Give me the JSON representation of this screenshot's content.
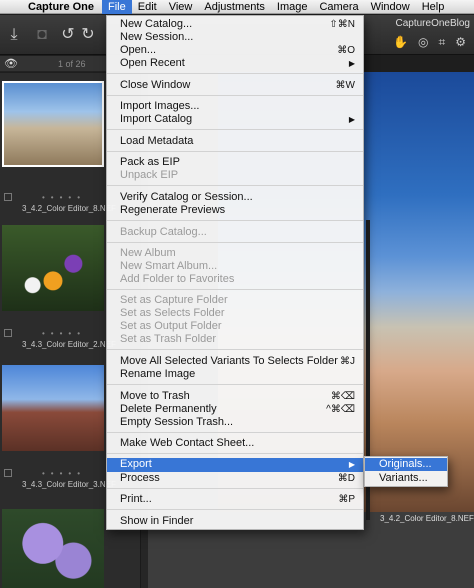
{
  "menubar": {
    "app_name": "Capture One",
    "items": [
      "File",
      "Edit",
      "View",
      "Adjustments",
      "Image",
      "Camera",
      "Window",
      "Help"
    ],
    "apple_icon": "apple-icon"
  },
  "toolbar": {
    "document_title": "CaptureOneBlog",
    "icons": [
      "import-icon",
      "camera-icon",
      "rotate-left-icon",
      "rotate-right-icon",
      "pan-tool-icon",
      "loupe-icon",
      "crop-icon",
      "settings-icon"
    ]
  },
  "browser": {
    "count": "1 of 26",
    "thumbnails": [
      {
        "caption": "3_4.2_Color Editor_8.NEF"
      },
      {
        "caption": "3_4.3_Color Editor_2.NEF"
      },
      {
        "caption": "3_4.3_Color Editor_3.NEF"
      },
      {
        "caption": ""
      }
    ]
  },
  "viewer": {
    "caption": "3_4.2_Color Editor_8.NEF"
  },
  "file_menu": {
    "items": [
      {
        "label": "New Catalog...",
        "shortcut": "⇧⌘N"
      },
      {
        "label": "New Session...",
        "shortcut": ""
      },
      {
        "label": "Open...",
        "shortcut": "⌘O"
      },
      {
        "label": "Open Recent",
        "submenu": true
      },
      {
        "label": "Close Window",
        "shortcut": "⌘W"
      },
      {
        "label": "Import Images...",
        "shortcut": ""
      },
      {
        "label": "Import Catalog",
        "submenu": true
      },
      {
        "label": "Load Metadata",
        "shortcut": ""
      },
      {
        "label": "Pack as EIP",
        "shortcut": ""
      },
      {
        "label": "Unpack EIP",
        "disabled": true
      },
      {
        "label": "Verify Catalog or Session...",
        "shortcut": ""
      },
      {
        "label": "Regenerate Previews",
        "shortcut": ""
      },
      {
        "label": "Backup Catalog...",
        "disabled": true
      },
      {
        "label": "New Album",
        "disabled": true
      },
      {
        "label": "New Smart Album...",
        "disabled": true
      },
      {
        "label": "Add Folder to Favorites",
        "disabled": true
      },
      {
        "label": "Set as Capture Folder",
        "disabled": true
      },
      {
        "label": "Set as Selects Folder",
        "disabled": true
      },
      {
        "label": "Set as Output Folder",
        "disabled": true
      },
      {
        "label": "Set as Trash Folder",
        "disabled": true
      },
      {
        "label": "Move All Selected Variants To Selects Folder",
        "shortcut": "⌘J"
      },
      {
        "label": "Rename Image",
        "shortcut": ""
      },
      {
        "label": "Move to Trash",
        "shortcut": "⌘⌫"
      },
      {
        "label": "Delete Permanently",
        "shortcut": "^⌘⌫"
      },
      {
        "label": "Empty Session Trash...",
        "shortcut": ""
      },
      {
        "label": "Make Web Contact Sheet...",
        "shortcut": ""
      },
      {
        "label": "Export",
        "submenu": true,
        "highlighted": true
      },
      {
        "label": "Process",
        "shortcut": "⌘D"
      },
      {
        "label": "Print...",
        "shortcut": "⌘P"
      },
      {
        "label": "Show in Finder",
        "shortcut": ""
      }
    ]
  },
  "export_submenu": {
    "items": [
      "Originals...",
      "Variants..."
    ]
  },
  "colors": {
    "highlight": "#3876d6",
    "menu_bg": "#f6f6f6",
    "app_bg": "#2c2c2c"
  }
}
